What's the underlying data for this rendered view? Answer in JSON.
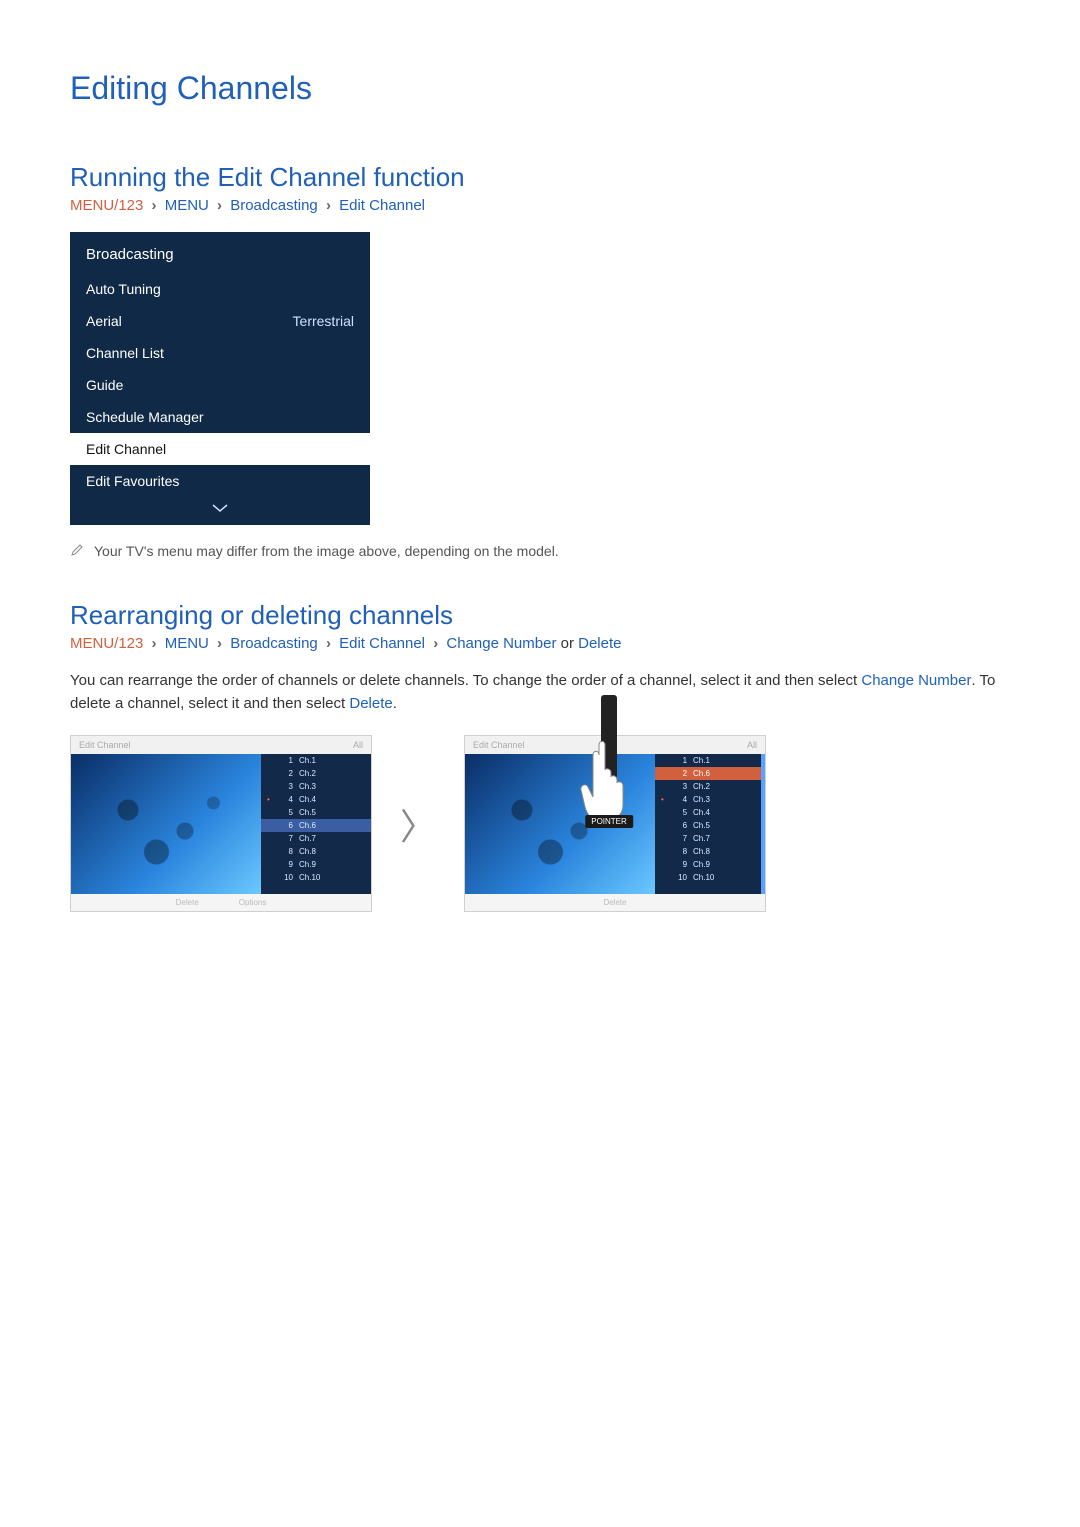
{
  "page_title": "Editing Channels",
  "section1": {
    "title": "Running the Edit Channel function",
    "breadcrumb": {
      "a": "MENU/123",
      "b": "MENU",
      "c": "Broadcasting",
      "d": "Edit Channel"
    }
  },
  "menu": {
    "header": "Broadcasting",
    "items": [
      {
        "label": "Auto Tuning",
        "value": ""
      },
      {
        "label": "Aerial",
        "value": "Terrestrial"
      },
      {
        "label": "Channel List",
        "value": ""
      },
      {
        "label": "Guide",
        "value": ""
      },
      {
        "label": "Schedule Manager",
        "value": ""
      },
      {
        "label": "Edit Channel",
        "value": "",
        "selected": true
      },
      {
        "label": "Edit Favourites",
        "value": ""
      }
    ]
  },
  "note": "Your TV's menu may differ from the image above, depending on the model.",
  "section2": {
    "title": "Rearranging or deleting channels",
    "breadcrumb": {
      "a": "MENU/123",
      "b": "MENU",
      "c": "Broadcasting",
      "d": "Edit Channel",
      "e": "Change Number",
      "or": "or",
      "f": "Delete"
    },
    "body_pre": "You can rearrange the order of channels or delete channels. To change the order of a channel, select it and then select ",
    "term1": "Change Number",
    "body_mid": ". To delete a channel, select it and then select ",
    "term2": "Delete",
    "body_post": "."
  },
  "shot_left": {
    "title": "Edit Channel",
    "tab": "All",
    "bottom": [
      "Delete",
      "Options"
    ],
    "channels": [
      {
        "n": "1",
        "name": "Ch.1"
      },
      {
        "n": "2",
        "name": "Ch.2"
      },
      {
        "n": "3",
        "name": "Ch.3"
      },
      {
        "n": "4",
        "name": "Ch.4",
        "marked": true
      },
      {
        "n": "5",
        "name": "Ch.5"
      },
      {
        "n": "6",
        "name": "Ch.6",
        "sel": true
      },
      {
        "n": "7",
        "name": "Ch.7"
      },
      {
        "n": "8",
        "name": "Ch.8"
      },
      {
        "n": "9",
        "name": "Ch.9"
      },
      {
        "n": "10",
        "name": "Ch.10"
      }
    ]
  },
  "shot_right": {
    "title": "Edit Channel",
    "tab": "All",
    "bottom": [
      "Delete"
    ],
    "channels": [
      {
        "n": "1",
        "name": "Ch.1"
      },
      {
        "n": "2",
        "name": "Ch.6",
        "hi": true
      },
      {
        "n": "3",
        "name": "Ch.2"
      },
      {
        "n": "4",
        "name": "Ch.3",
        "marked": true
      },
      {
        "n": "5",
        "name": "Ch.4"
      },
      {
        "n": "6",
        "name": "Ch.5"
      },
      {
        "n": "7",
        "name": "Ch.7"
      },
      {
        "n": "8",
        "name": "Ch.8"
      },
      {
        "n": "9",
        "name": "Ch.9"
      },
      {
        "n": "10",
        "name": "Ch.10"
      }
    ]
  },
  "remote_button": "POINTER"
}
